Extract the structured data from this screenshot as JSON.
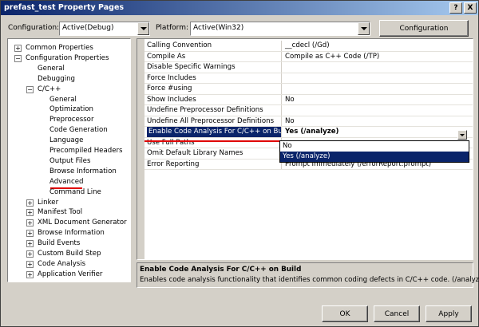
{
  "window": {
    "title": "prefast_test Property Pages",
    "help_button": "?",
    "close_button": "X"
  },
  "toolbar": {
    "configuration_label": "Configuration:",
    "configuration_value": "Active(Debug)",
    "platform_label": "Platform:",
    "platform_value": "Active(Win32)",
    "config_manager_button": "Configuration Manager..."
  },
  "tree": {
    "items": [
      {
        "label": "Common Properties",
        "expander": "+"
      },
      {
        "label": "Configuration Properties",
        "expander": "−"
      },
      {
        "label": "General"
      },
      {
        "label": "Debugging"
      },
      {
        "label": "C/C++",
        "expander": "−"
      },
      {
        "label": "General"
      },
      {
        "label": "Optimization"
      },
      {
        "label": "Preprocessor"
      },
      {
        "label": "Code Generation"
      },
      {
        "label": "Language"
      },
      {
        "label": "Precompiled Headers"
      },
      {
        "label": "Output Files"
      },
      {
        "label": "Browse Information"
      },
      {
        "label": "Advanced"
      },
      {
        "label": "Command Line"
      },
      {
        "label": "Linker",
        "expander": "+"
      },
      {
        "label": "Manifest Tool",
        "expander": "+"
      },
      {
        "label": "XML Document Generator",
        "expander": "+"
      },
      {
        "label": "Browse Information",
        "expander": "+"
      },
      {
        "label": "Build Events",
        "expander": "+"
      },
      {
        "label": "Custom Build Step",
        "expander": "+"
      },
      {
        "label": "Code Analysis",
        "expander": "+"
      },
      {
        "label": "Application Verifier",
        "expander": "+"
      }
    ]
  },
  "grid": {
    "rows": [
      {
        "name": "Calling Convention",
        "value": "__cdecl (/Gd)"
      },
      {
        "name": "Compile As",
        "value": "Compile as C++ Code (/TP)"
      },
      {
        "name": "Disable Specific Warnings",
        "value": ""
      },
      {
        "name": "Force Includes",
        "value": ""
      },
      {
        "name": "Force #using",
        "value": ""
      },
      {
        "name": "Show Includes",
        "value": "No"
      },
      {
        "name": "Undefine Preprocessor Definitions",
        "value": ""
      },
      {
        "name": "Undefine All Preprocessor Definitions",
        "value": "No"
      },
      {
        "name": "Enable Code Analysis For C/C++ on Build",
        "value": "Yes (/analyze)"
      },
      {
        "name": "Use Full Paths",
        "value": ""
      },
      {
        "name": "Omit Default Library Names",
        "value": ""
      },
      {
        "name": "Error Reporting",
        "value": "Prompt Immediately (/errorReport:prompt)"
      }
    ],
    "dropdown_options": [
      "No",
      "Yes (/analyze)"
    ]
  },
  "description": {
    "title": "Enable Code Analysis For C/C++ on Build",
    "text": "Enables code analysis functionality that identifies common coding defects in C/C++ code.     (/analyze)"
  },
  "footer": {
    "ok": "OK",
    "cancel": "Cancel",
    "apply": "Apply"
  },
  "colors": {
    "selection": "#0a246a",
    "annotation": "#e00000"
  }
}
